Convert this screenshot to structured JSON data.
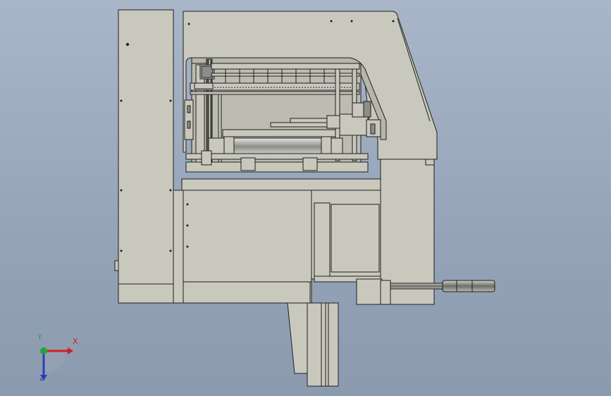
{
  "view": {
    "background_top": "#a9b6c9",
    "background_bottom": "#8c9ab0",
    "part_fill": "#c9c8bd",
    "part_shadow": "#b7b6aa",
    "edge_color": "#1e1e1e"
  },
  "triad": {
    "x_label": "X",
    "y_label": "Y",
    "z_label": "Z",
    "x_color": "#d41d1d",
    "y_color": "#1fa63a",
    "z_color": "#2b3fb8"
  }
}
